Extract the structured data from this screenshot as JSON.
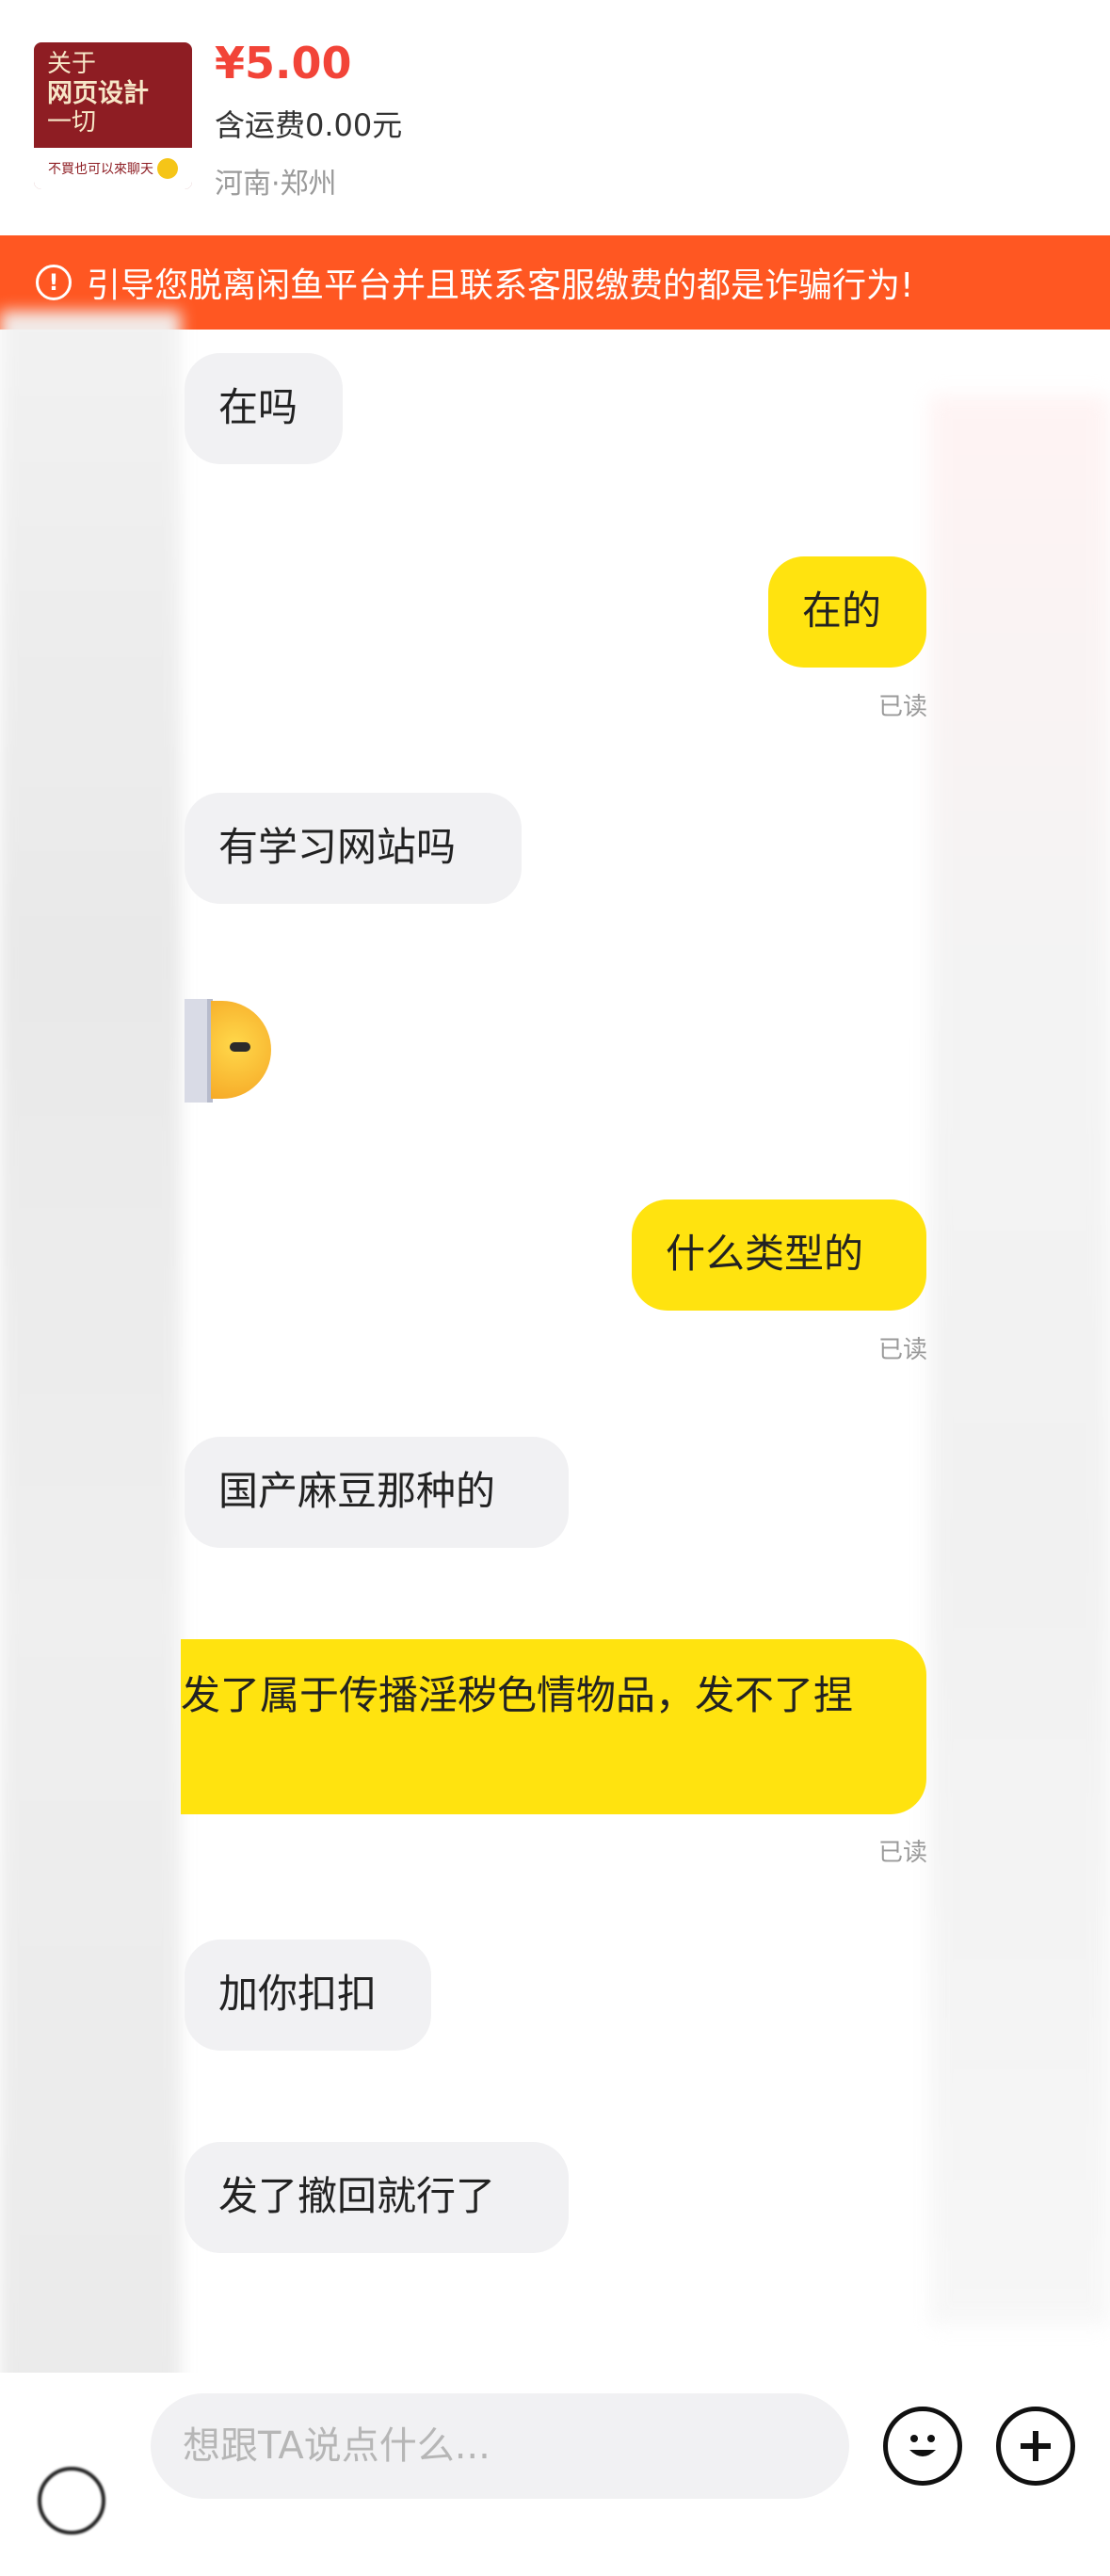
{
  "product": {
    "thumb_line1": "关于",
    "thumb_line2": "网页设計",
    "thumb_line3": "一切",
    "thumb_caption": "不買也可以來聊天",
    "price": "¥5.00",
    "shipping": "含运费0.00元",
    "location": "河南·郑州"
  },
  "warning": {
    "text": "引导您脱离闲鱼平台并且联系客服缴费的都是诈骗行为!"
  },
  "messages": [
    {
      "side": "in",
      "text": "在吗"
    },
    {
      "side": "out",
      "text": "在的",
      "status": "已读"
    },
    {
      "side": "in",
      "text": "有学习网站吗"
    },
    {
      "side": "in",
      "emoji": "thinking-face-emoji"
    },
    {
      "side": "out",
      "text": "什么类型的",
      "status": "已读"
    },
    {
      "side": "in",
      "text": "国产麻豆那种的"
    },
    {
      "side": "out",
      "text": "发了属于传播淫秽色情物品，发不了捏",
      "status": "已读"
    },
    {
      "side": "in",
      "text": "加你扣扣"
    },
    {
      "side": "in",
      "text": "发了撤回就行了"
    }
  ],
  "input": {
    "placeholder": "想跟TA说点什么..."
  },
  "colors": {
    "warning_bg": "#ff5722",
    "price": "#f24438",
    "outgoing_bubble": "#ffe30f",
    "incoming_bubble": "#f1f1f3"
  }
}
